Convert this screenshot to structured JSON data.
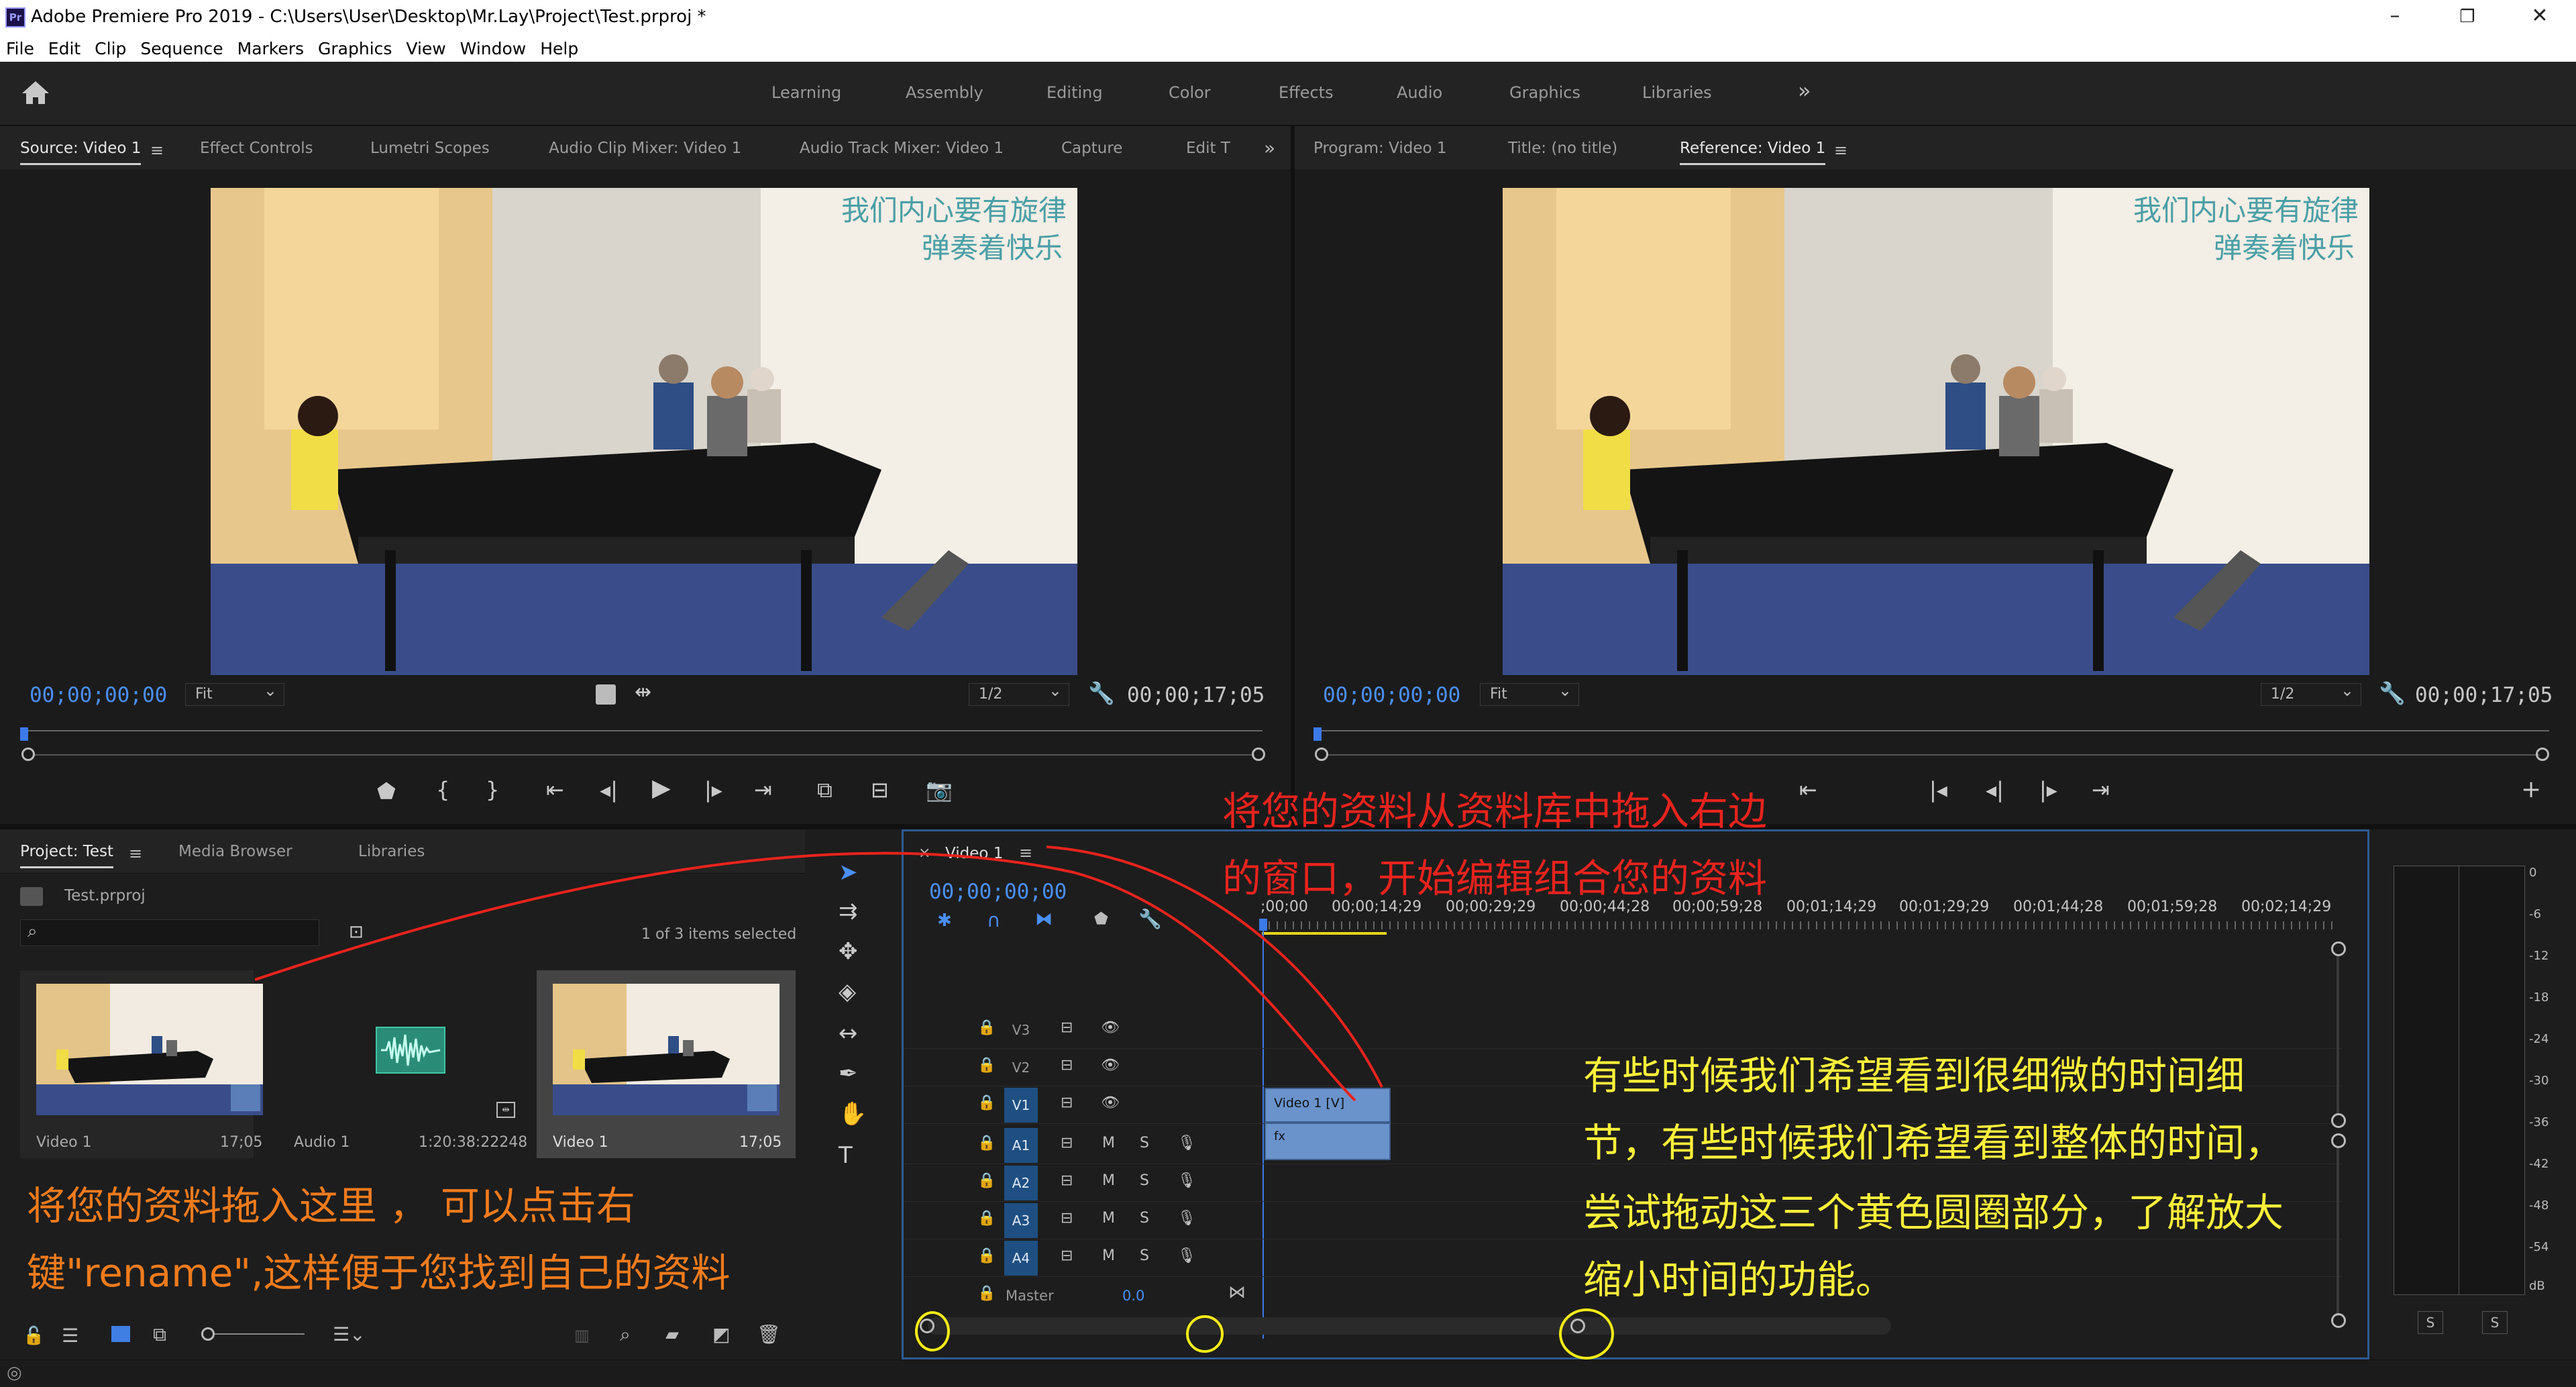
{
  "window": {
    "title": "Adobe Premiere Pro 2019 - C:\\Users\\User\\Desktop\\Mr.Lay\\Project\\Test.prproj *",
    "logo": "Pr"
  },
  "menu": [
    "File",
    "Edit",
    "Clip",
    "Sequence",
    "Markers",
    "Graphics",
    "View",
    "Window",
    "Help"
  ],
  "workspaces": [
    "Learning",
    "Assembly",
    "Editing",
    "Color",
    "Effects",
    "Audio",
    "Graphics",
    "Libraries"
  ],
  "source_panel": {
    "tabs": [
      "Source: Video 1",
      "Effect Controls",
      "Lumetri Scopes",
      "Audio Clip Mixer: Video 1",
      "Audio Track Mixer: Video 1",
      "Capture",
      "Edit T"
    ],
    "timecode_in": "00;00;00;00",
    "zoom": "Fit",
    "resolution": "1/2",
    "duration": "00;00;17;05"
  },
  "program_panel": {
    "tabs": [
      "Program: Video 1",
      "Title: (no title)",
      "Reference: Video 1"
    ],
    "timecode_in": "00;00;00;00",
    "zoom": "Fit",
    "resolution": "1/2",
    "duration": "00;00;17;05"
  },
  "frame_text": {
    "line1": "我们内心要有旋律",
    "line2": "弹奏着快乐"
  },
  "project_panel": {
    "tabs": [
      "Project: Test",
      "Media Browser",
      "Libraries"
    ],
    "file": "Test.prproj",
    "search_placeholder": "",
    "selection": "1 of 3 items selected",
    "items": [
      {
        "name": "Video 1",
        "duration": "17;05"
      },
      {
        "name": "Audio 1",
        "duration": "1:20:38:22248"
      },
      {
        "name": "Video 1",
        "duration": "17;05"
      }
    ]
  },
  "timeline": {
    "tab": "Video 1",
    "timecode": "00;00;00;00",
    "ruler": [
      ";00;00",
      "00;00;14;29",
      "00;00;29;29",
      "00;00;44;28",
      "00;00;59;28",
      "00;01;14;29",
      "00;01;29;29",
      "00;01;44;28",
      "00;01;59;28",
      "00;02;14;29"
    ],
    "video_tracks": [
      "V3",
      "V2",
      "V1"
    ],
    "audio_tracks": [
      "A1",
      "A2",
      "A3",
      "A4"
    ],
    "clip_label": "Video 1 [V]",
    "master_label": "Master",
    "master_value": "0.0",
    "mute": "M",
    "solo": "S"
  },
  "meter": {
    "scale": [
      "0",
      "-6",
      "-12",
      "-18",
      "-24",
      "-30",
      "-36",
      "-42",
      "-48",
      "-54",
      "dB"
    ],
    "solo_left": "S",
    "solo_right": "S"
  },
  "annotations": {
    "top_line1": "将您的资料从资料库中拖入右边",
    "top_line2": "的窗口，开始编辑组合您的资料",
    "left_line1": "将您的资料拖入这里 ， 可以点击右",
    "left_line2": "键\"rename\",这样便于您找到自己的资料",
    "right_line1": "有些时候我们希望看到很细微的时间细",
    "right_line2": "节，有些时候我们希望看到整体的时间，",
    "right_line3": "尝试拖动这三个黄色圆圈部分，了解放大",
    "right_line4": "缩小时间的功能。"
  },
  "colors": {
    "accent_blue": "#4a8ff7",
    "track_enabled": "#1f4f82",
    "clip": "#6a93cc",
    "annotation_red": "#e8231d",
    "annotation_orange": "#f07b1c",
    "annotation_yellow": "#fff03a"
  }
}
